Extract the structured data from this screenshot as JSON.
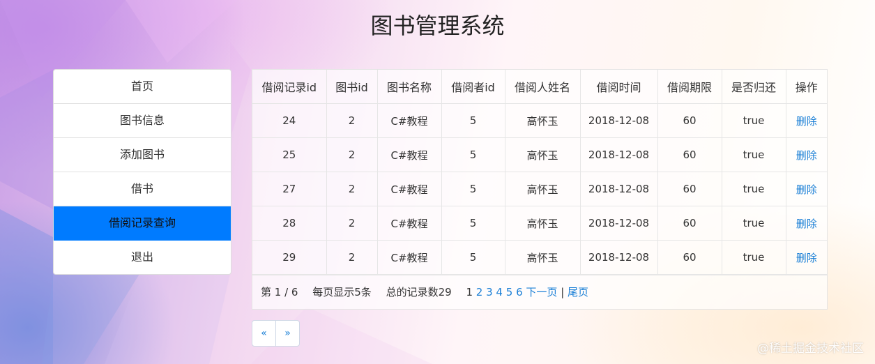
{
  "page": {
    "title": "图书管理系统",
    "watermark": "@稀土掘金技术社区"
  },
  "menu": {
    "items": [
      "首页",
      "图书信息",
      "添加图书",
      "借书",
      "借阅记录查询",
      "退出"
    ],
    "active_index": 4,
    "accent": "#007bff"
  },
  "table": {
    "headers": [
      "借阅记录id",
      "图书id",
      "图书名称",
      "借阅者id",
      "借阅人姓名",
      "借阅时间",
      "借阅期限",
      "是否归还",
      "操作"
    ],
    "rows": [
      [
        "24",
        "2",
        "C#教程",
        "5",
        "高怀玉",
        "2018-12-08",
        "60",
        "true",
        "删除"
      ],
      [
        "25",
        "2",
        "C#教程",
        "5",
        "高怀玉",
        "2018-12-08",
        "60",
        "true",
        "删除"
      ],
      [
        "27",
        "2",
        "C#教程",
        "5",
        "高怀玉",
        "2018-12-08",
        "60",
        "true",
        "删除"
      ],
      [
        "28",
        "2",
        "C#教程",
        "5",
        "高怀玉",
        "2018-12-08",
        "60",
        "true",
        "删除"
      ],
      [
        "29",
        "2",
        "C#教程",
        "5",
        "高怀玉",
        "2018-12-08",
        "60",
        "true",
        "删除"
      ]
    ],
    "link_color": "#1a7fd6"
  },
  "pager": {
    "page_info": "第 1 / 6",
    "per_page": "每页显示5条",
    "total": "总的记录数29",
    "current_page": "1",
    "pages": [
      "2",
      "3",
      "4",
      "5",
      "6"
    ],
    "next": "下一页",
    "separator": "|",
    "last": "尾页"
  },
  "pagination": {
    "prev": "«",
    "next": "»"
  }
}
